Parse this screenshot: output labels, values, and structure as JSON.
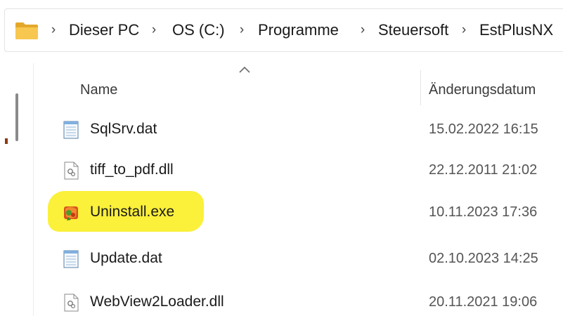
{
  "breadcrumb": {
    "items": [
      {
        "label": "Dieser PC"
      },
      {
        "label": "OS (C:)"
      },
      {
        "label": "Programme"
      },
      {
        "label": "Steuersoft"
      },
      {
        "label": "EstPlusNX"
      }
    ]
  },
  "columns": {
    "name": "Name",
    "date": "Änderungsdatum",
    "sorted_by": "Name"
  },
  "files": [
    {
      "name": "SqlSrv.dat",
      "date": "15.02.2022 16:15",
      "icon": "dat-file-icon"
    },
    {
      "name": "tiff_to_pdf.dll",
      "date": "22.12.2011 21:02",
      "icon": "dll-file-icon"
    },
    {
      "name": "Uninstall.exe",
      "date": "10.11.2023 17:36",
      "icon": "uninstall-exe-icon",
      "highlighted": true
    },
    {
      "name": "Update.dat",
      "date": "02.10.2023 14:25",
      "icon": "dat-file-icon"
    },
    {
      "name": "WebView2Loader.dll",
      "date": "20.11.2021 19:06",
      "icon": "dll-file-icon"
    }
  ],
  "colors": {
    "highlight": "#fbf03a",
    "folder": "#f4b942"
  }
}
